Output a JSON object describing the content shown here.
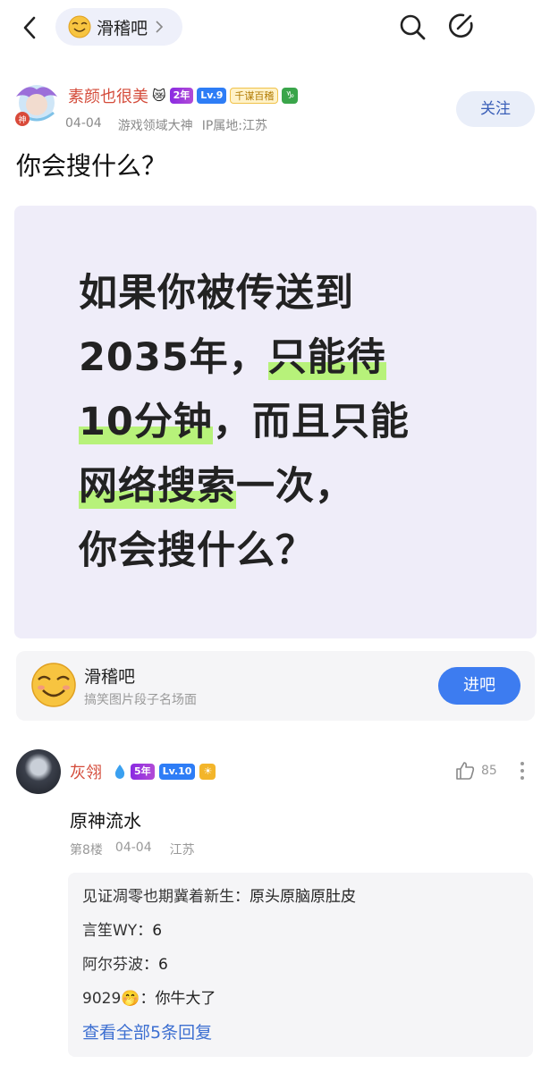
{
  "topbar": {
    "forum_name": "滑稽吧"
  },
  "post": {
    "author": "素颜也很美",
    "badges": {
      "years": "2年",
      "level": "Lv.9",
      "rank": "千谋百稽",
      "zodiac": "♑"
    },
    "avatar_tag": "神",
    "date": "04-04",
    "title_tag": "游戏领域大神",
    "ip": "IP属地:江苏",
    "follow_label": "关注",
    "title": "你会搜什么？",
    "image_lines": [
      [
        "如果你被传送到",
        ""
      ],
      [
        "2035年，",
        "只能待"
      ],
      [
        "10分钟",
        "，而且只能"
      ],
      [
        "网络搜索",
        "一次，"
      ],
      [
        "你会搜什么？",
        ""
      ]
    ]
  },
  "forum_card": {
    "name": "滑稽吧",
    "desc": "搞笑图片段子名场面",
    "enter_label": "进吧"
  },
  "comment": {
    "author": "灰翎",
    "badges": {
      "years": "5年",
      "level": "Lv.10"
    },
    "likes": "85",
    "text": "原神流水",
    "floor": "第8楼",
    "date": "04-04",
    "location": "江苏",
    "replies": [
      {
        "name": "见证凋零也期冀着新生",
        "sep": "：",
        "text": "原头原脑原肚皮"
      },
      {
        "name": "言笙WY",
        "sep": "：",
        "text": "6"
      },
      {
        "name": "阿尔芬波",
        "sep": "：",
        "text": "6"
      },
      {
        "name": "9029🤭",
        "sep": "：",
        "text": "你牛大了"
      }
    ],
    "view_all": "查看全部5条回复"
  },
  "colors": {
    "accent": "#3d7cf0",
    "username": "#d44b3a",
    "highlight": "#b7f27a"
  }
}
